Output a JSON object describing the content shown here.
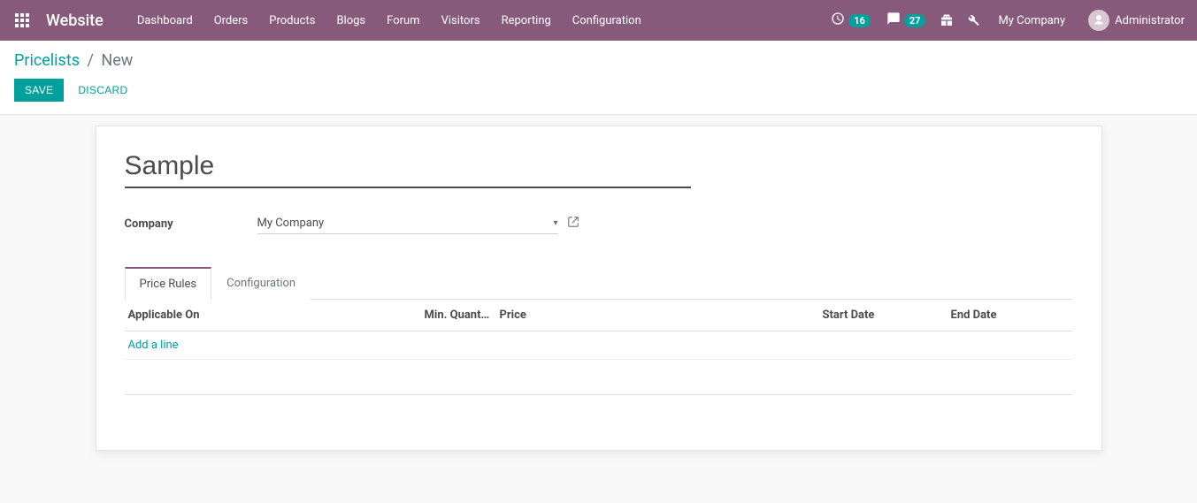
{
  "navbar": {
    "brand": "Website",
    "menu": [
      "Dashboard",
      "Orders",
      "Products",
      "Blogs",
      "Forum",
      "Visitors",
      "Reporting",
      "Configuration"
    ],
    "clock_badge": "16",
    "chat_badge": "27",
    "company": "My Company",
    "user": "Administrator"
  },
  "breadcrumb": {
    "root": "Pricelists",
    "current": "New"
  },
  "buttons": {
    "save": "SAVE",
    "discard": "DISCARD"
  },
  "form": {
    "title_value": "Sample",
    "company_label": "Company",
    "company_value": "My Company"
  },
  "tabs": {
    "price_rules": "Price Rules",
    "configuration": "Configuration"
  },
  "table": {
    "columns": {
      "applicable_on": "Applicable On",
      "min_quantity": "Min. Quant…",
      "price": "Price",
      "start_date": "Start Date",
      "end_date": "End Date"
    },
    "add_line": "Add a line"
  }
}
